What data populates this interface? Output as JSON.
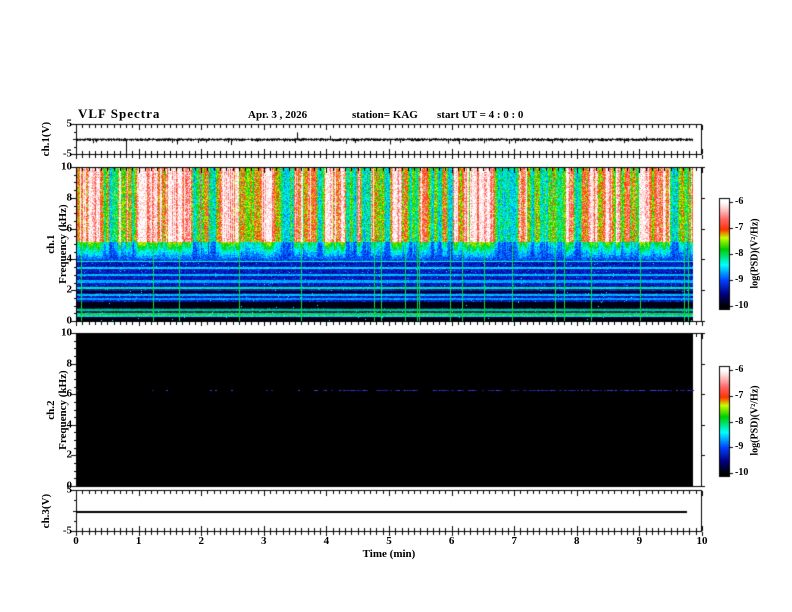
{
  "header": {
    "title": "VLF Spectra",
    "date": "Apr. 3 , 2026",
    "station": "station= KAG",
    "start_ut": "start UT =  4 : 0 : 0"
  },
  "axes": {
    "xlabel": "Time (min)",
    "xticks": [
      0,
      1,
      2,
      3,
      4,
      5,
      6,
      7,
      8,
      9,
      10
    ],
    "x_range_min": [
      0,
      10
    ]
  },
  "panels": {
    "ch1_wave": {
      "ylabel": "ch.1(V)",
      "yticks": [
        5,
        -5
      ],
      "ylim": [
        -5,
        5
      ]
    },
    "ch1_spec": {
      "ylabel_line1": "ch.1",
      "ylabel_line2": "Frequency (kHz)",
      "yticks": [
        10,
        8,
        6,
        4,
        2,
        0
      ],
      "ylim": [
        0,
        10
      ]
    },
    "ch2_spec": {
      "ylabel_line1": "ch.2",
      "ylabel_line2": "Frequency (kHz)",
      "yticks": [
        10,
        8,
        6,
        4,
        2,
        0
      ],
      "ylim": [
        0,
        10
      ]
    },
    "ch3_wave": {
      "ylabel": "ch.3(V)",
      "yticks": [
        5,
        -5
      ],
      "ylim": [
        -5,
        5
      ]
    }
  },
  "colorbars": [
    {
      "label": "log(PSD)(V²/Hz)",
      "ticks": [
        -6,
        -7,
        -8,
        -9,
        -10
      ],
      "range": [
        -10,
        -6
      ]
    },
    {
      "label": "log(PSD)(V²/Hz)",
      "ticks": [
        -6,
        -7,
        -8,
        -9,
        -10
      ],
      "range": [
        -10,
        -6
      ]
    }
  ],
  "chart_data": [
    {
      "type": "line",
      "name": "ch.1 voltage time series",
      "ylabel": "ch.1(V)",
      "xlim": [
        0,
        10
      ],
      "ylim": [
        -5,
        5
      ],
      "yticks": [
        5,
        -5
      ],
      "baseline_V": 0,
      "noise_band_V": 0.4,
      "spikes": [
        {
          "t_min": 0.27,
          "v_V": -1.2
        },
        {
          "t_min": 0.8,
          "v_V": -4.2
        },
        {
          "t_min": 1.62,
          "v_V": -1.6
        },
        {
          "t_min": 2.48,
          "v_V": -1.8
        },
        {
          "t_min": 3.53,
          "v_V": 2.3
        },
        {
          "t_min": 4.06,
          "v_V": 1.2
        },
        {
          "t_min": 4.32,
          "v_V": -1.4
        },
        {
          "t_min": 5.02,
          "v_V": -1.6
        },
        {
          "t_min": 6.12,
          "v_V": -1.5
        },
        {
          "t_min": 7.02,
          "v_V": -1.2
        },
        {
          "t_min": 7.76,
          "v_V": -1.1
        },
        {
          "t_min": 9.1,
          "v_V": 0.9
        }
      ],
      "data_end_min": 9.85,
      "seed": 11
    },
    {
      "type": "heatmap",
      "name": "ch.1 VLF spectrogram",
      "ylabel": "ch.1 Frequency (kHz)",
      "xlim": [
        0,
        10
      ],
      "ylim": [
        0,
        10
      ],
      "zlabel": "log(PSD)(V²/Hz)",
      "zlim": [
        -10,
        -6
      ],
      "colormap_stops": [
        [
          0.0,
          "#000000"
        ],
        [
          0.12,
          "#000080"
        ],
        [
          0.25,
          "#0040ff"
        ],
        [
          0.4,
          "#00ffff"
        ],
        [
          0.55,
          "#00cc00"
        ],
        [
          0.66,
          "#ccff00"
        ],
        [
          0.74,
          "#ff3300"
        ],
        [
          0.84,
          "#ff6666"
        ],
        [
          0.92,
          "#ffbbbb"
        ],
        [
          1.0,
          "#ffffff"
        ]
      ],
      "structure": {
        "sferic_band": {
          "f_min_khz": 5.2,
          "f_max_khz": 10,
          "level_range": [
            -8.8,
            -6.1
          ],
          "vertical_striations": true
        },
        "transition_band": {
          "f_min_khz": 4.0,
          "f_max_khz": 5.2,
          "level_range": [
            -9.3,
            -7.7
          ]
        },
        "low_band": {
          "f_min_khz": 0,
          "f_max_khz": 4.0,
          "level_range": [
            -10,
            -9.0
          ]
        },
        "horizontal_lines": [
          {
            "f_khz": 3.95,
            "boost": 0.9
          },
          {
            "f_khz": 3.5,
            "boost": 0.6
          },
          {
            "f_khz": 3.05,
            "boost": 0.5
          },
          {
            "f_khz": 2.65,
            "boost": 0.45
          },
          {
            "f_khz": 2.22,
            "boost": 1.0
          },
          {
            "f_khz": 1.78,
            "boost": 0.5
          },
          {
            "f_khz": 1.5,
            "boost": 0.4
          },
          {
            "f_khz": 0.78,
            "boost": 1.3
          },
          {
            "f_khz": 0.55,
            "boost": 1.5
          },
          {
            "f_khz": 0.42,
            "boost": 0.6
          }
        ],
        "black_bands_khz": [
          [
            0,
            0.33
          ],
          [
            0.95,
            1.3
          ],
          [
            1.9,
            2.05
          ]
        ],
        "vertical_line_fraction": 0.045,
        "white_column_fraction": 0.05
      },
      "data_end_min": 9.85,
      "seed": 42
    },
    {
      "type": "heatmap",
      "name": "ch.2 VLF spectrogram",
      "ylabel": "ch.2 Frequency (kHz)",
      "xlim": [
        0,
        10
      ],
      "ylim": [
        0,
        10
      ],
      "zlabel": "log(PSD)(V²/Hz)",
      "zlim": [
        -10,
        -6
      ],
      "background_level": -10,
      "emission_line": {
        "freq_khz": 6.3,
        "level": -9.3,
        "style": "broken",
        "sparse_from_min": 2.2,
        "dense_from_min": 4.2
      },
      "data_end_min": 9.85,
      "seed": 7
    },
    {
      "type": "line",
      "name": "ch.3 voltage time series",
      "ylabel": "ch.3(V)",
      "xlim": [
        0,
        10
      ],
      "ylim": [
        -5,
        5
      ],
      "yticks": [
        5,
        -5
      ],
      "constant_value_V": -0.2,
      "data_end_min": 9.76
    }
  ]
}
